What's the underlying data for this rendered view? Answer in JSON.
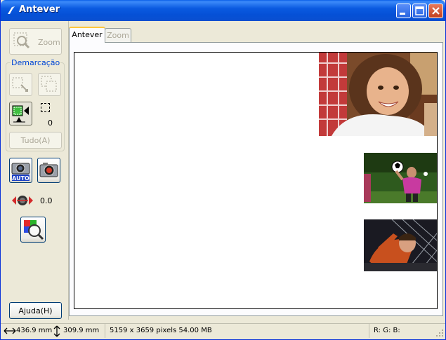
{
  "window": {
    "title": "Antever"
  },
  "left_panel": {
    "zoom_label": "Zoom",
    "marquee_group_label": "Demarcação",
    "marquee_count": "0",
    "all_label": "Tudo(A)",
    "exposure_value": "0.0",
    "help_label": "Ajuda(H)"
  },
  "tabs": [
    {
      "label": "Antever",
      "active": true
    },
    {
      "label": "Zoom",
      "active": false
    }
  ],
  "status": {
    "width": "436.9 mm",
    "height": "309.9 mm",
    "pixels": "5159 x 3659 pixels 54.00 MB",
    "rgb": "R: G: B:"
  },
  "colors": {
    "title_bar": "#0a5ae0",
    "accent_blue": "#0046d5",
    "tab_highlight": "#ffc73c"
  }
}
